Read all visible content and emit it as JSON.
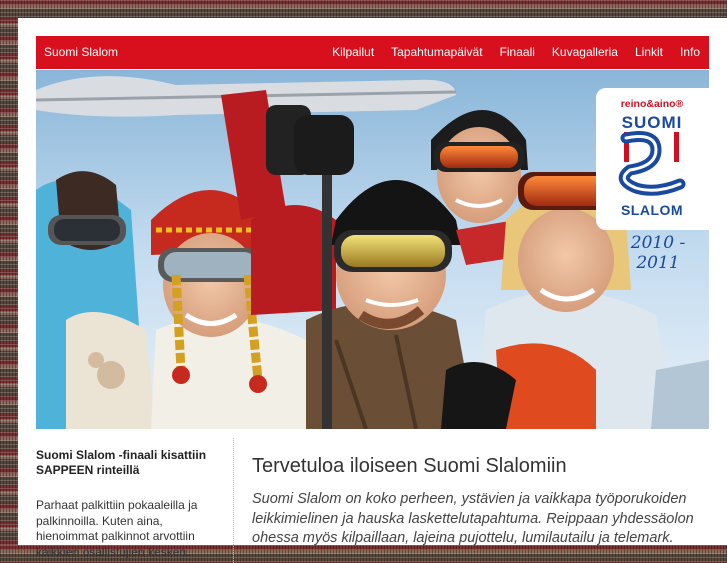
{
  "nav": {
    "brand": "Suomi Slalom",
    "items": [
      {
        "label": "Kilpailut"
      },
      {
        "label": "Tapahtumapäivät"
      },
      {
        "label": "Finaali"
      },
      {
        "label": "Kuvagalleria"
      },
      {
        "label": "Linkit"
      },
      {
        "label": "Info"
      }
    ]
  },
  "logo": {
    "brand": "reino&aino®",
    "line1": "SUOMI",
    "line2": "SLALOM",
    "season": "2010 - 2011"
  },
  "sidebar": {
    "title": "Suomi Slalom -finaali kisattiin SAPPEEN rinteillä",
    "text": "Parhaat palkittiin pokaaleilla ja palkinnoilla. Kuten aina, hienoimmat palkinnot arvottiin kaikkien osallistujien kesken."
  },
  "main": {
    "heading": "Tervetuloa iloiseen Suomi Slalomiin",
    "intro": "Suomi Slalom on koko perheen, ystävien ja vaikkapa työporukoiden leikkimielinen ja hauska laskettelutapahtuma. Reippaan yhdessäolon ohessa myös kilpaillaan, lajeina pujottelu, lumilautailu ja telemark."
  },
  "colors": {
    "nav_red": "#d80f1c",
    "logo_blue": "#1a4aa0",
    "logo_red": "#d01020"
  }
}
